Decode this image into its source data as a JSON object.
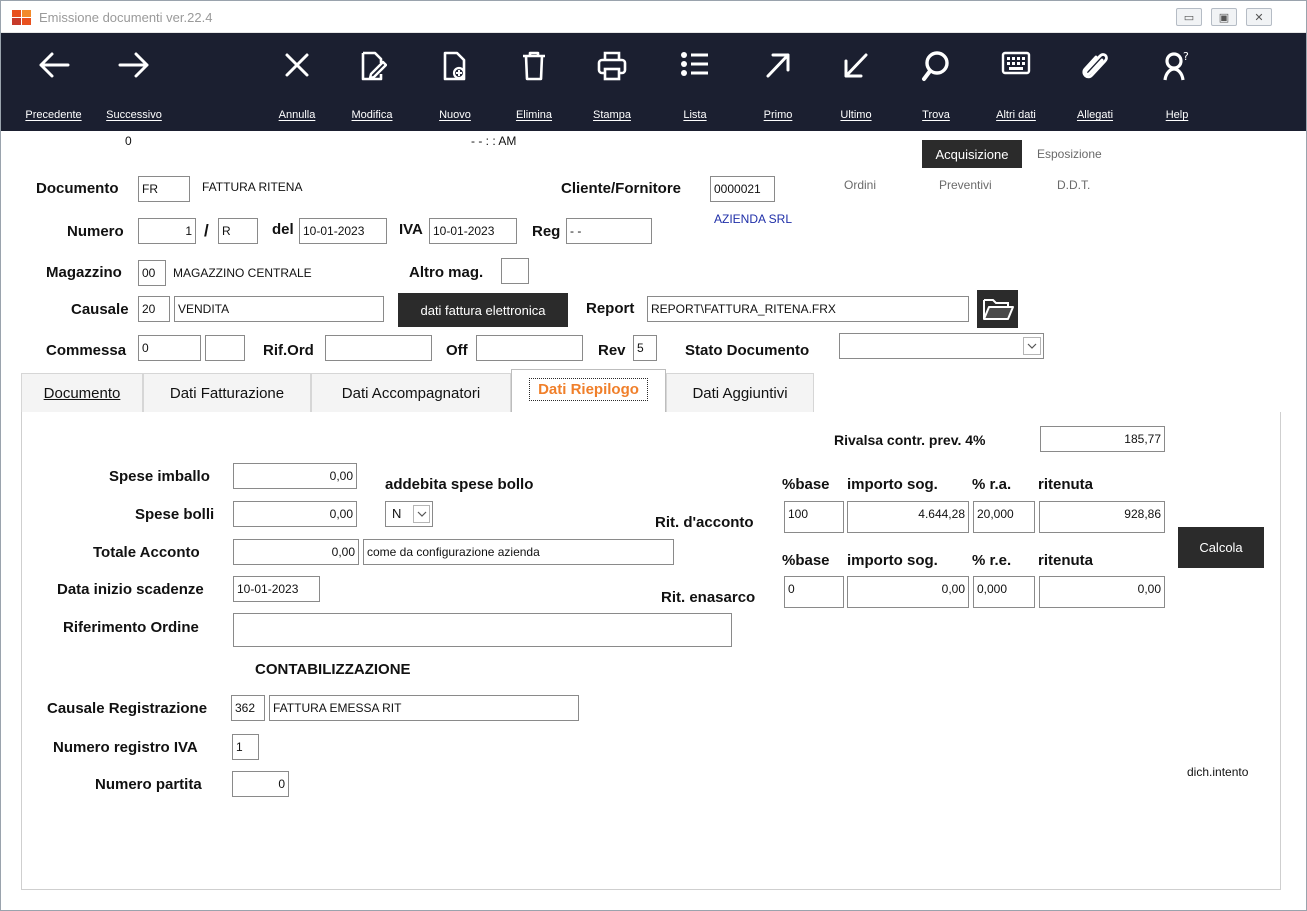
{
  "window": {
    "title": "Emissione documenti  ver.22.4"
  },
  "toolbar": {
    "precedente": "Precedente",
    "successivo": "Successivo",
    "annulla": "Annulla",
    "modifica": "Modifica",
    "nuovo": "Nuovo",
    "elimina": "Elimina",
    "stampa": "Stampa",
    "lista": "Lista",
    "primo": "Primo",
    "ultimo": "Ultimo",
    "trova": "Trova",
    "altri_dati": "Altri dati",
    "allegati": "Allegati",
    "help": "Help"
  },
  "status": {
    "record": "0",
    "datetime": "- -    : :  AM"
  },
  "side_tabs": {
    "acquisizione": "Acquisizione",
    "esposizione": "Esposizione",
    "ordini": "Ordini",
    "preventivi": "Preventivi",
    "ddt": "D.D.T."
  },
  "header": {
    "documento_label": "Documento",
    "documento_code": "FR",
    "documento_desc": "FATTURA RITENA",
    "cliente_label": "Cliente/Fornitore",
    "cliente_code": "0000021",
    "cliente_name": "AZIENDA SRL",
    "numero_label": "Numero",
    "numero": "1",
    "slash": "/",
    "serie": "R",
    "del_label": "del",
    "del_date": "10-01-2023",
    "iva_label": "IVA",
    "iva_date": "10-01-2023",
    "reg_label": "Reg",
    "reg_value": "- -",
    "magazzino_label": "Magazzino",
    "magazzino_code": "00",
    "magazzino_desc": "MAGAZZINO CENTRALE",
    "altro_mag_label": "Altro mag.",
    "altro_mag_value": "",
    "causale_label": "Causale",
    "causale_code": "20",
    "causale_desc": "VENDITA",
    "fattura_elettronica_button": "dati fattura elettronica",
    "report_label": "Report",
    "report_path": "REPORT\\FATTURA_RITENA.FRX",
    "commessa_label": "Commessa",
    "commessa_value": "0",
    "commessa_value2": "",
    "rif_ord_label": "Rif.Ord",
    "rif_ord_value": "",
    "off_label": "Off",
    "off_value": "",
    "rev_label": "Rev",
    "rev_value": "5",
    "stato_label": "Stato Documento",
    "stato_value": ""
  },
  "tabs": {
    "documento": "Documento",
    "dati_fatturazione": "Dati Fatturazione",
    "dati_accompagnatori": "Dati Accompagnatori",
    "dati_riepilogo": "Dati Riepilogo",
    "dati_aggiuntivi": "Dati Aggiuntivi"
  },
  "riepilogo": {
    "rivalsa_label": "Rivalsa contr. prev. 4%",
    "rivalsa_value": "185,77",
    "spese_imballo_label": "Spese imballo",
    "spese_imballo_value": "0,00",
    "addebita_label": "addebita spese bollo",
    "addebita_value": "N",
    "spese_bolli_label": "Spese bolli",
    "spese_bolli_value": "0,00",
    "totale_acconto_label": "Totale Acconto",
    "totale_acconto_value": "0,00",
    "totale_acconto_note": "come da configurazione azienda",
    "data_inizio_label": "Data inizio scadenze",
    "data_inizio_value": "10-01-2023",
    "riferimento_label": "Riferimento Ordine",
    "riferimento_value": "",
    "contab_title": "CONTABILIZZAZIONE",
    "causale_reg_label": "Causale Registrazione",
    "causale_reg_code": "362",
    "causale_reg_desc": "FATTURA EMESSA RIT",
    "num_reg_iva_label": "Numero registro IVA",
    "num_reg_iva_value": "1",
    "num_partita_label": "Numero partita",
    "num_partita_value": "0",
    "hdr_base": "%base",
    "hdr_importo": "importo sog.",
    "hdr_ra": "% r.a.",
    "hdr_ritenuta": "ritenuta",
    "rit_acconto_label": "Rit. d'acconto",
    "rit_acconto_base": "100",
    "rit_acconto_importo": "4.644,28",
    "rit_acconto_perc": "20,000",
    "rit_acconto_ritenuta": "928,86",
    "hdr_base2": "%base",
    "hdr_importo2": "importo sog.",
    "hdr_re": "% r.e.",
    "hdr_ritenuta2": "ritenuta",
    "rit_enasarco_label": "Rit. enasarco",
    "rit_enasarco_base": "0",
    "rit_enasarco_importo": "0,00",
    "rit_enasarco_perc": "0,000",
    "rit_enasarco_ritenuta": "0,00",
    "calcola_button": "Calcola",
    "dich_intento": "dich.intento"
  }
}
